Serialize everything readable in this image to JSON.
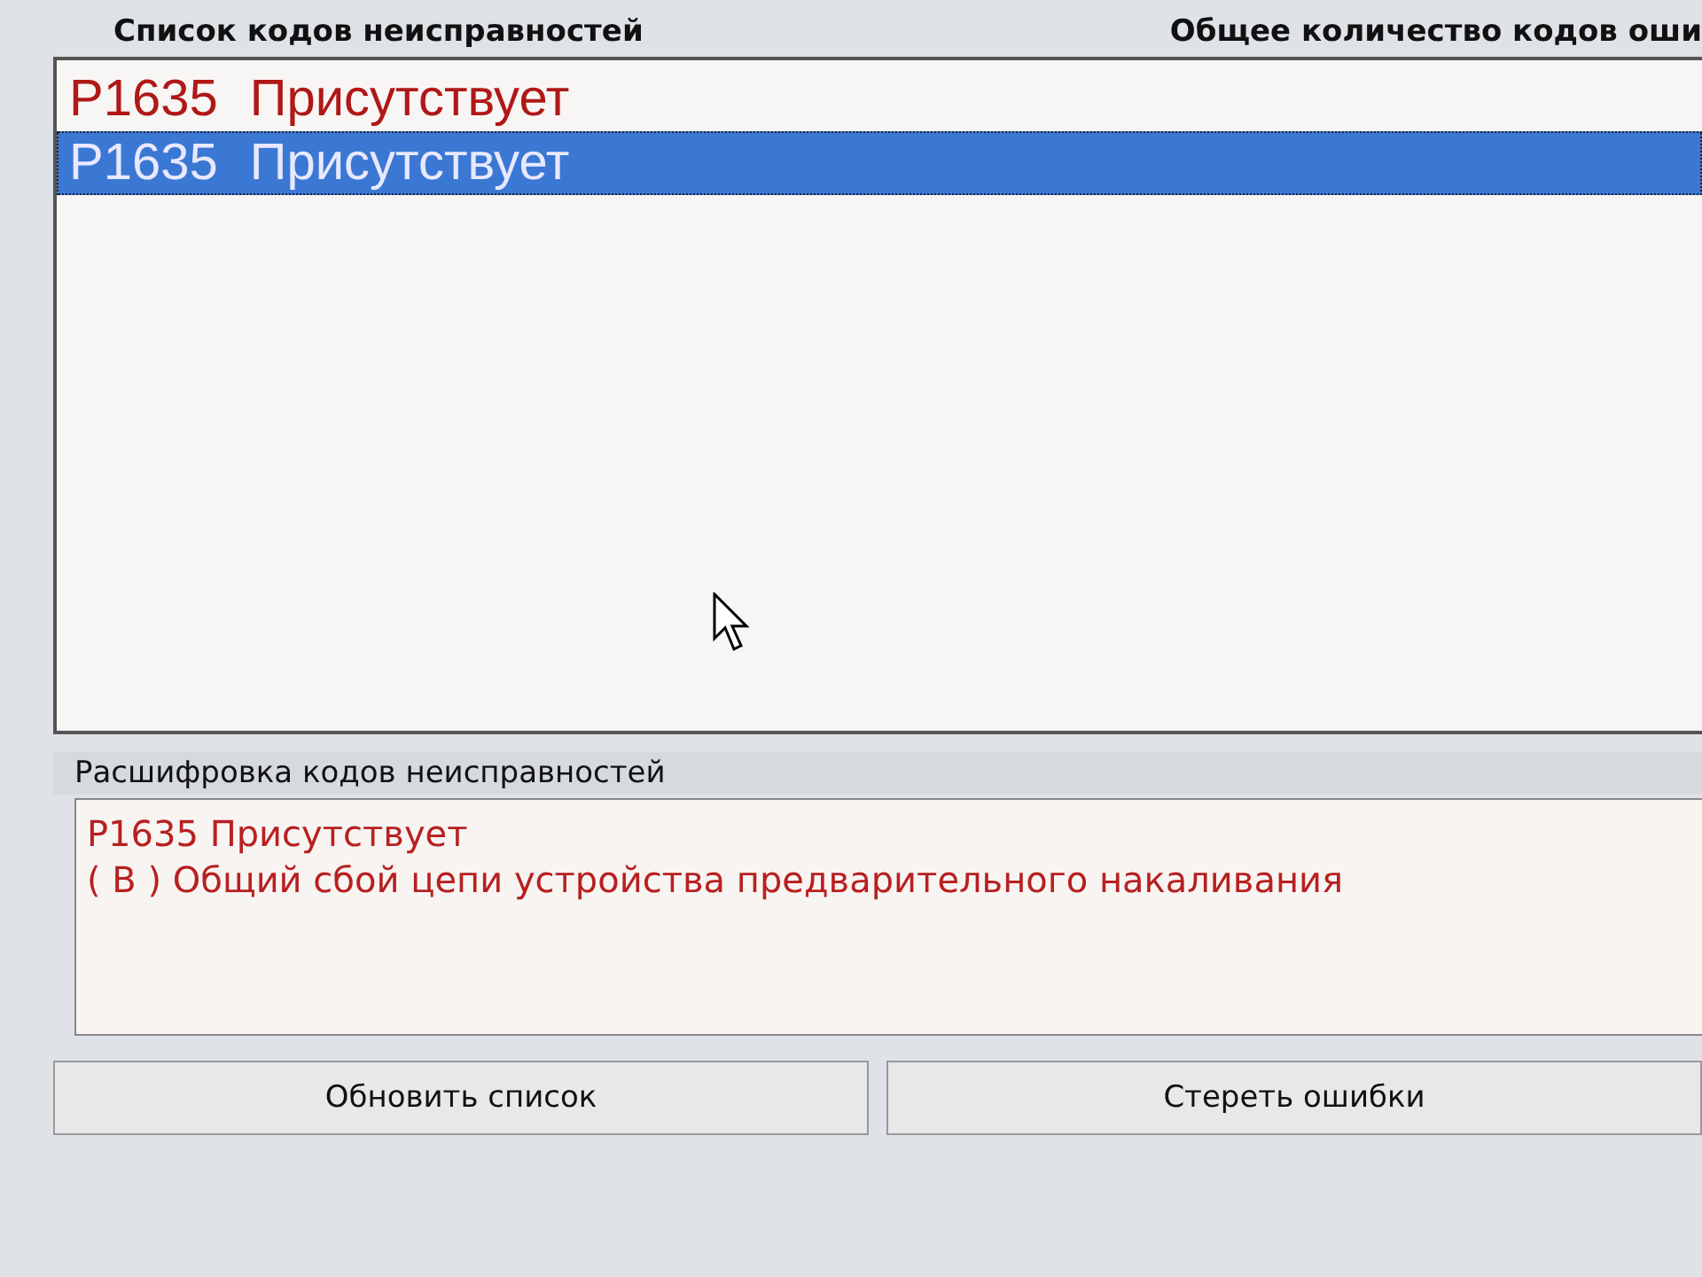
{
  "header": {
    "list_title": "Список кодов неисправностей",
    "count_title": "Общее количество кодов оши"
  },
  "codes": [
    {
      "code": "P1635",
      "status": "Присутствует",
      "selected": false
    },
    {
      "code": "P1635",
      "status": "Присутствует",
      "selected": true
    }
  ],
  "decode": {
    "title": "Расшифровка кодов неисправностей",
    "lines": [
      "P1635  Присутствует",
      "( B )  Общий сбой цепи устройства предварительного накаливания"
    ]
  },
  "buttons": [
    "Обновить список",
    "Стереть ошибки"
  ]
}
